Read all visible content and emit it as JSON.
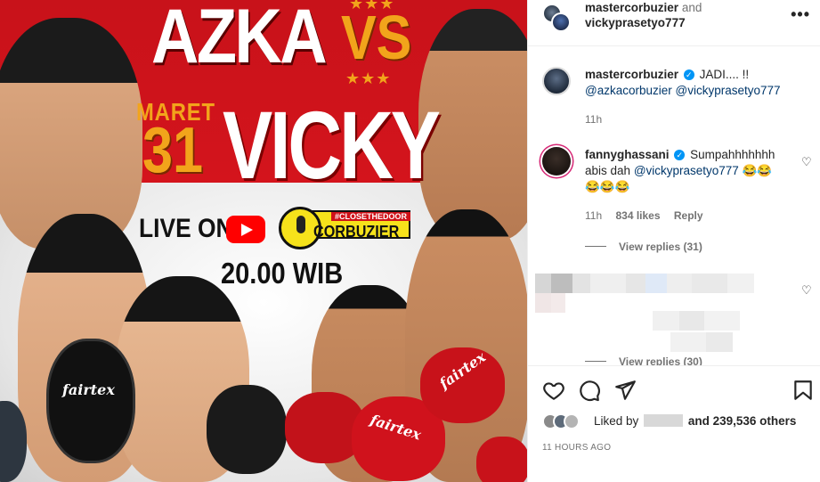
{
  "poster": {
    "title_left": "AZKA",
    "vs": "VS",
    "stars": "★★★",
    "month": "MARET",
    "day": "31",
    "title_right": "VICKY",
    "live_on": "LIVE ON",
    "channel_tag": "#CLOSETHEDOOR",
    "channel_name": "CORBUZIER",
    "time": "20.00 WIB",
    "brand": "fairtex"
  },
  "header": {
    "user1": "mastercorbuzier",
    "conj": "and",
    "user2": "vickyprasetyo777",
    "more_icon": "•••"
  },
  "comments": [
    {
      "user": "mastercorbuzier",
      "text": "JADI.... !!",
      "mention1": "@azkacorbuzier",
      "mention2": "@vickyprasetyo777",
      "time": "11h"
    },
    {
      "user": "fannyghassani",
      "text_before": "Sumpahhhhhhh abis dah",
      "mention": "@vickyprasetyo777",
      "emojis_line1": "😂😂",
      "emojis_line2": "😂😂😂",
      "time": "11h",
      "likes": "834 likes",
      "reply": "Reply",
      "view_replies": "View replies (31)"
    },
    {
      "view_replies": "View replies (30)"
    }
  ],
  "actions": {
    "liked_by": "Liked by",
    "and_others": "and 239,536 others",
    "time_ago": "11 HOURS AGO"
  },
  "colors": {
    "verified": "#0095f6",
    "link": "#00376b",
    "muted": "#737373",
    "poster_red": "#d4141c",
    "poster_gold": "#f2a41b"
  }
}
